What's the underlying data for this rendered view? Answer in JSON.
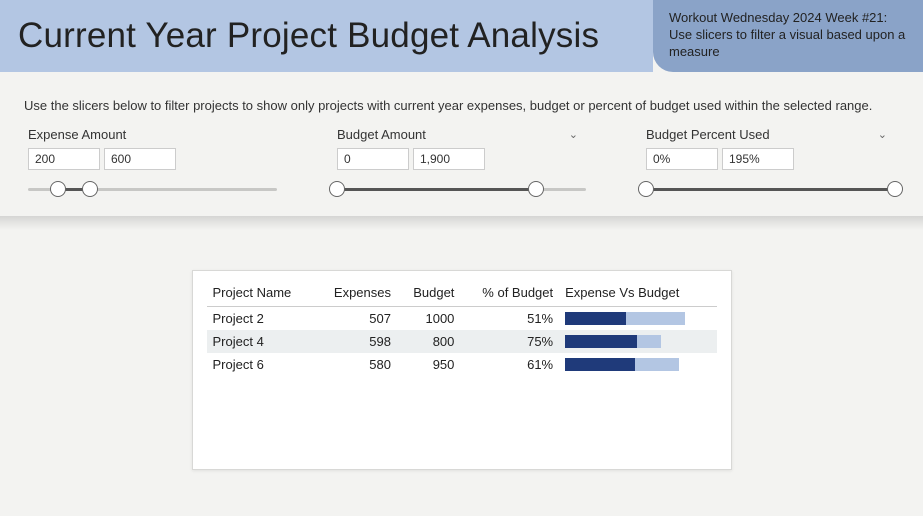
{
  "header": {
    "title": "Current Year Project Budget Analysis",
    "side_text": "Workout Wednesday 2024 Week #21: Use slicers to filter a visual based upon a measure"
  },
  "instructions": "Use the slicers below to filter projects to show only projects with current year expenses, budget or percent of budget used within the selected range.",
  "slicers": {
    "expense": {
      "label": "Expense Amount",
      "min_value": "200",
      "max_value": "600",
      "low_pct": 12,
      "high_pct": 25
    },
    "budget": {
      "label": "Budget Amount",
      "min_value": "0",
      "max_value": "1,900",
      "low_pct": 0,
      "high_pct": 80
    },
    "percent": {
      "label": "Budget Percent Used",
      "min_value": "0%",
      "max_value": "195%",
      "low_pct": 0,
      "high_pct": 100
    }
  },
  "table": {
    "columns": [
      "Project Name",
      "Expenses",
      "Budget",
      "% of Budget",
      "Expense Vs Budget"
    ],
    "rows": [
      {
        "name": "Project 2",
        "expenses": "507",
        "budget": "1000",
        "pct": "51%",
        "bar_bg": 100,
        "bar_fg": 51
      },
      {
        "name": "Project 4",
        "expenses": "598",
        "budget": "800",
        "pct": "75%",
        "bar_bg": 80,
        "bar_fg": 60
      },
      {
        "name": "Project 6",
        "expenses": "580",
        "budget": "950",
        "pct": "61%",
        "bar_bg": 95,
        "bar_fg": 58
      }
    ]
  },
  "chart_data": {
    "type": "table",
    "title": "Current Year Project Budget Analysis",
    "columns": [
      "Project Name",
      "Expenses",
      "Budget",
      "% of Budget"
    ],
    "rows": [
      {
        "Project Name": "Project 2",
        "Expenses": 507,
        "Budget": 1000,
        "% of Budget": 51
      },
      {
        "Project Name": "Project 4",
        "Expenses": 598,
        "Budget": 800,
        "% of Budget": 75
      },
      {
        "Project Name": "Project 6",
        "Expenses": 580,
        "Budget": 950,
        "% of Budget": 61
      }
    ],
    "bar_column": {
      "name": "Expense Vs Budget",
      "note": "Dark bar = Expenses, light bar = Budget (scaled to max budget 1000)"
    },
    "slicer_ranges": {
      "Expense Amount": [
        200,
        600
      ],
      "Budget Amount": [
        0,
        1900
      ],
      "Budget Percent Used": [
        0,
        195
      ]
    }
  }
}
